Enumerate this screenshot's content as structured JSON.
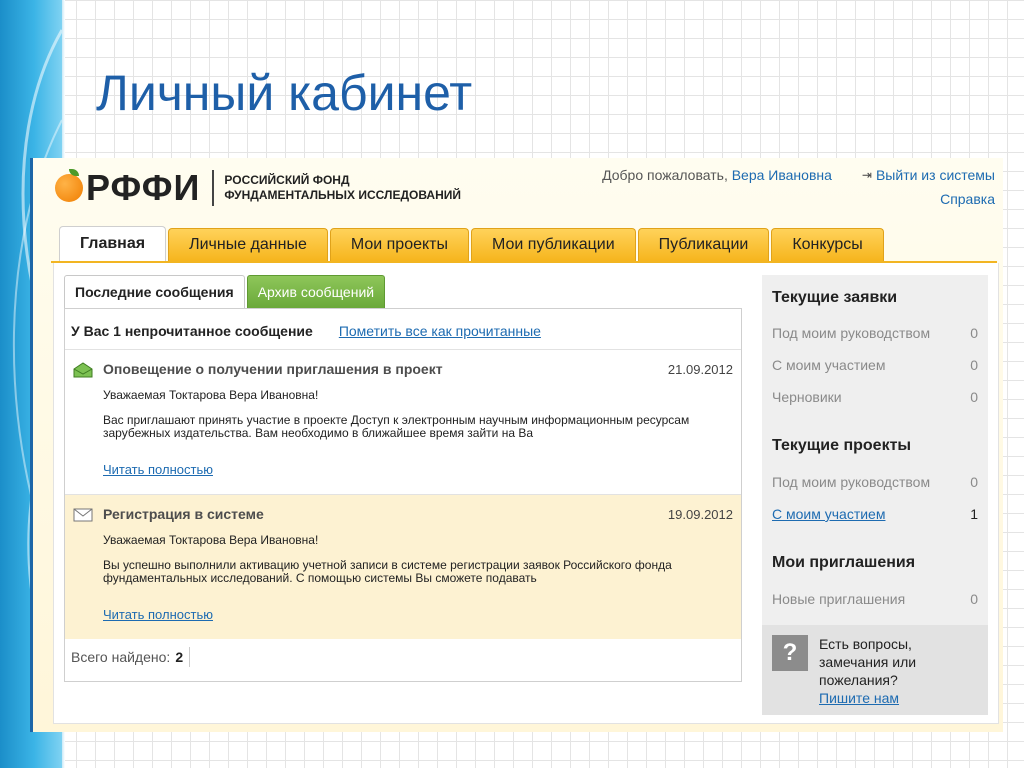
{
  "slide": {
    "title": "Личный кабинет"
  },
  "header": {
    "logo_text": "РФФИ",
    "logo_full_line1": "РОССИЙСКИЙ ФОНД",
    "logo_full_line2": "ФУНДАМЕНТАЛЬНЫХ ИССЛЕДОВАНИЙ",
    "welcome": "Добро пожаловать,",
    "user_name": "Вера Ивановна",
    "logout": "Выйти из системы",
    "help": "Справка"
  },
  "nav": {
    "tabs": [
      {
        "label": "Главная"
      },
      {
        "label": "Личные данные"
      },
      {
        "label": "Мои проекты"
      },
      {
        "label": "Мои публикации"
      },
      {
        "label": "Публикации"
      },
      {
        "label": "Конкурсы"
      }
    ]
  },
  "messages": {
    "tabs": [
      {
        "label": "Последние сообщения"
      },
      {
        "label": "Архив сообщений"
      }
    ],
    "unread": "У Вас 1 непрочитанное сообщение",
    "mark_all": "Пометить все как прочитанные",
    "items": [
      {
        "title": "Оповещение о получении приглашения в проект",
        "date": "21.09.2012",
        "greeting": "Уважаемая Токтарова Вера Ивановна!",
        "body": "Вас приглашают принять участие в проекте Доступ к электронным научным информационным ресурсам зарубежных издательства. Вам необходимо в ближайшее время зайти на Ва",
        "read_more": "Читать полностью"
      },
      {
        "title": "Регистрация в системе",
        "date": "19.09.2012",
        "greeting": "Уважаемая Токтарова Вера Ивановна!",
        "body": "Вы успешно выполнили активацию учетной записи в системе регистрации заявок Российского фонда фундаментальных исследований. С помощью системы Вы сможете подавать",
        "read_more": "Читать полностью"
      }
    ],
    "found_label": "Всего найдено:",
    "found_count": "2"
  },
  "sidebar": {
    "applications": {
      "title": "Текущие заявки",
      "rows": [
        {
          "label": "Под моим руководством",
          "value": "0"
        },
        {
          "label": "С моим участием",
          "value": "0"
        },
        {
          "label": "Черновики",
          "value": "0"
        }
      ]
    },
    "projects": {
      "title": "Текущие проекты",
      "rows": [
        {
          "label": "Под моим руководством",
          "value": "0"
        },
        {
          "label": "С моим участием",
          "value": "1"
        }
      ]
    },
    "invitations": {
      "title": "Мои приглашения",
      "rows": [
        {
          "label": "Новые приглашения",
          "value": "0"
        }
      ]
    },
    "help": {
      "icon": "?",
      "text": "Есть вопросы, замечания или пожелания?",
      "link": "Пишите нам"
    }
  },
  "colors": {
    "accent_blue": "#1d6bb1",
    "tab_orange": "#f6b51d",
    "archive_green": "#6aa93a",
    "title_blue": "#1e5fa8"
  }
}
